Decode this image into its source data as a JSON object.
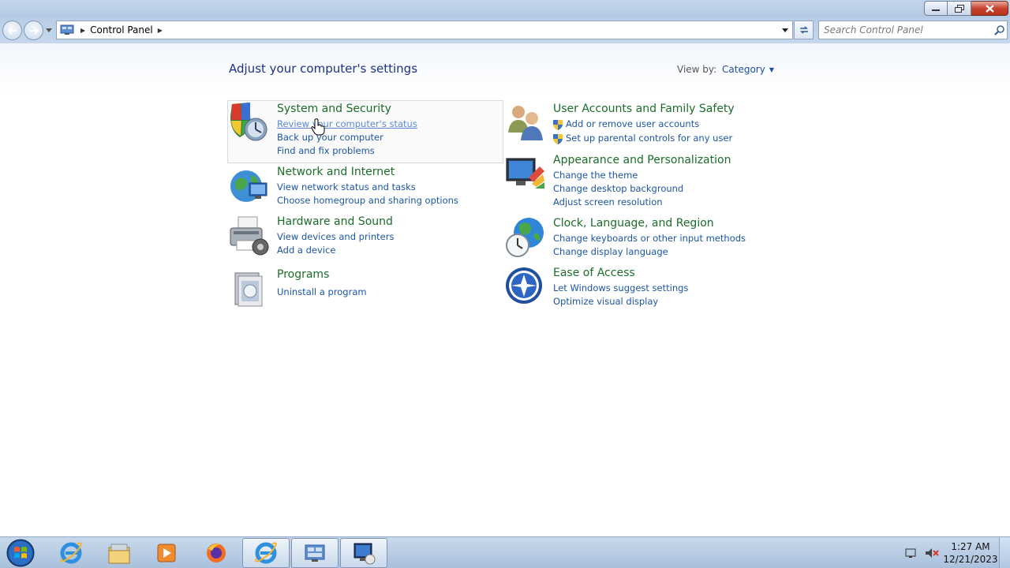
{
  "window": {
    "buttons": {
      "minimize": "minimize-icon",
      "maximize": "restore-icon",
      "close": "close-icon"
    }
  },
  "address_bar": {
    "breadcrumb": [
      "Control Panel"
    ],
    "search_placeholder": "Search Control Panel"
  },
  "main": {
    "title": "Adjust your computer's settings",
    "view_by_label": "View by:",
    "view_by_value": "Category",
    "left_categories": [
      {
        "title": "System and Security",
        "icon": "shield-icon",
        "links": [
          "Review your computer's status",
          "Back up your computer",
          "Find and fix problems"
        ]
      },
      {
        "title": "Network and Internet",
        "icon": "network-globe-icon",
        "links": [
          "View network status and tasks",
          "Choose homegroup and sharing options"
        ]
      },
      {
        "title": "Hardware and Sound",
        "icon": "printer-icon",
        "links": [
          "View devices and printers",
          "Add a device"
        ]
      },
      {
        "title": "Programs",
        "icon": "programs-icon",
        "links": [
          "Uninstall a program"
        ]
      }
    ],
    "right_categories": [
      {
        "title": "User Accounts and Family Safety",
        "icon": "users-icon",
        "links": [
          "Add or remove user accounts",
          "Set up parental controls for any user"
        ]
      },
      {
        "title": "Appearance and Personalization",
        "icon": "monitor-palette-icon",
        "links": [
          "Change the theme",
          "Change desktop background",
          "Adjust screen resolution"
        ]
      },
      {
        "title": "Clock, Language, and Region",
        "icon": "globe-clock-icon",
        "links": [
          "Change keyboards or other input methods",
          "Change display language"
        ]
      },
      {
        "title": "Ease of Access",
        "icon": "ease-of-access-icon",
        "links": [
          "Let Windows suggest settings",
          "Optimize visual display"
        ]
      }
    ]
  },
  "taskbar": {
    "items": [
      "start-orb-icon",
      "internet-explorer-icon",
      "file-explorer-icon",
      "media-player-icon",
      "firefox-icon",
      "internet-explorer-icon",
      "control-panel-icon",
      "remote-desktop-icon"
    ],
    "clock": {
      "time": "1:27 AM",
      "date": "12/21/2023"
    }
  },
  "colors": {
    "accent_link": "#1d55a5",
    "category_heading": "#1b6d29",
    "page_title": "#1e3287"
  }
}
